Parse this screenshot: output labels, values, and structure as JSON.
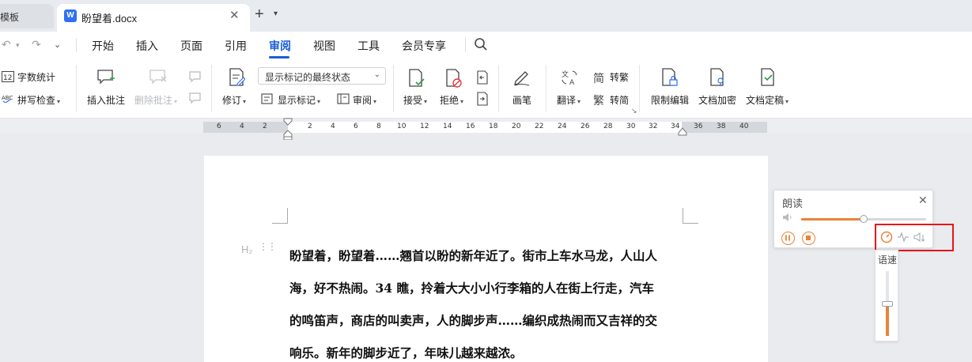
{
  "tabs": {
    "previous_label": "壳模板",
    "active_doc_icon": "W",
    "active_label": "盼望着.docx",
    "close_glyph": "✕",
    "new_tab_glyph": "+",
    "new_tab_dropdown": "▾"
  },
  "menu": {
    "undo_glyph": "↶",
    "redo_glyph": "↷",
    "items": [
      "开始",
      "插入",
      "页面",
      "引用",
      "审阅",
      "视图",
      "工具",
      "会员专享"
    ],
    "active": "审阅"
  },
  "ribbon": {
    "word_count": "字数统计",
    "word_count_icon_text": "12",
    "spell_check": "拼写检查",
    "spell_check_icon_text": "ABC",
    "insert_comment": "插入批注",
    "delete_comment": "删除批注",
    "revise": "修订",
    "markup_mode": "显示标记的最终状态",
    "show_markup": "显示标记",
    "review": "审阅",
    "accept": "接受",
    "reject": "拒绝",
    "pen": "画笔",
    "translate": "翻译",
    "to_traditional": "转繁",
    "to_simplified": "转简",
    "restrict_edit": "限制编辑",
    "encrypt": "文档加密",
    "finalize": "文档定稿"
  },
  "ruler": {
    "ticks": [
      "6",
      "4",
      "2",
      "2",
      "4",
      "6",
      "8",
      "10",
      "12",
      "14",
      "16",
      "18",
      "20",
      "22",
      "24",
      "26",
      "28",
      "30",
      "32",
      "34",
      "36",
      "38",
      "40"
    ]
  },
  "document": {
    "heading_marker": "H₂",
    "lines": [
      "盼望着，盼望着……翘首以盼的新年近了。街市上车水马龙，人山人",
      "海，好不热闹。34 瞧，拎着大大小小行李箱的人在街上行走，汽车",
      "的鸣笛声，商店的叫卖声，人的脚步声……编织成热闹而又吉祥的交",
      "响乐。新年的脚步近了，年味儿越来越浓。"
    ]
  },
  "read_aloud": {
    "title": "朗读",
    "close_glyph": "✕",
    "volume_level": 0.5,
    "speed_label": "语速",
    "speed_level": 0.5
  },
  "colors": {
    "accent_blue": "#1a5ed8",
    "accent_orange": "#e8833a",
    "highlight_red": "#e8141b"
  }
}
